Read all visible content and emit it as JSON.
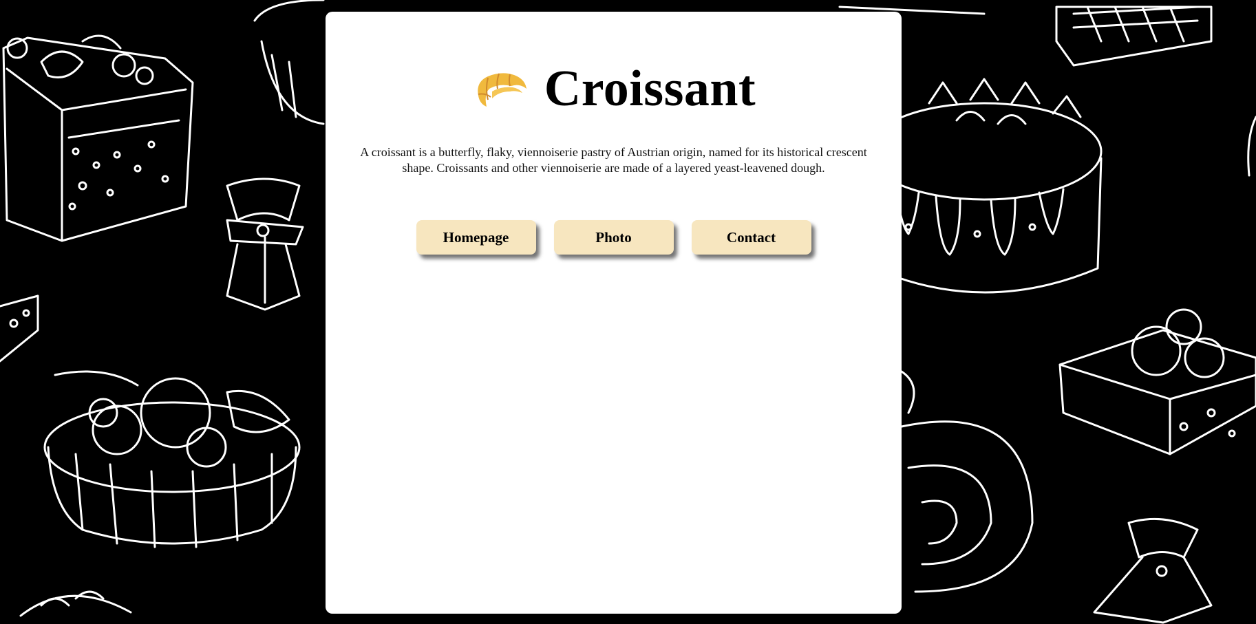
{
  "page": {
    "title": "Croissant",
    "description": "A croissant is a butterfly, flaky, viennoiserie pastry of Austrian origin, named for its historical crescent shape. Croissants and other viennoiserie are made of a layered yeast-leavened dough.",
    "title_icon": "croissant-icon"
  },
  "nav": {
    "items": [
      {
        "label": "Homepage"
      },
      {
        "label": "Photo"
      },
      {
        "label": "Contact"
      }
    ]
  },
  "colors": {
    "background": "#000000",
    "card": "#ffffff",
    "button": "#f7e6bf",
    "croissant": "#f0b93d",
    "sketch_lines": "#ffffff"
  },
  "background_pattern": "hand-drawn white-line dessert sketches on black"
}
